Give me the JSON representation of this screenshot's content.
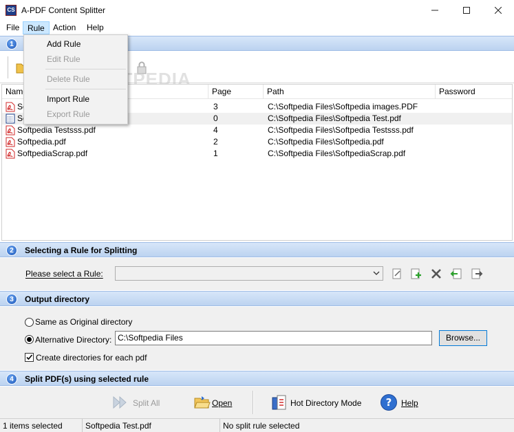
{
  "window": {
    "title": "A-PDF Content Splitter",
    "app_icon_text": "CS"
  },
  "menubar": {
    "items": [
      {
        "label": "File"
      },
      {
        "label": "Rule",
        "active": true
      },
      {
        "label": "Action"
      },
      {
        "label": "Help"
      }
    ]
  },
  "rule_menu": {
    "items": [
      {
        "label": "Add Rule",
        "enabled": true
      },
      {
        "label": "Edit Rule",
        "enabled": false
      },
      {
        "label": "Delete Rule",
        "enabled": false
      },
      {
        "label": "Import Rule",
        "enabled": true
      },
      {
        "label": "Export Rule",
        "enabled": false
      }
    ]
  },
  "section1": {
    "number": "1"
  },
  "watermark": "SOFTPEDIA",
  "filelist": {
    "columns": [
      "Name",
      "Page",
      "Path",
      "Password"
    ],
    "rows": [
      {
        "name": "Softpedia images.PDF",
        "page": "3",
        "path": "C:\\Softpedia Files\\Softpedia images.PDF",
        "password": "",
        "selected": false,
        "icon": "pdf-icon"
      },
      {
        "name": "Softpedia Test.pdf",
        "page": "0",
        "path": "C:\\Softpedia Files\\Softpedia Test.pdf",
        "password": "",
        "selected": true,
        "icon": "pdf-selected-icon"
      },
      {
        "name": "Softpedia Testsss.pdf",
        "page": "4",
        "path": "C:\\Softpedia Files\\Softpedia Testsss.pdf",
        "password": "",
        "selected": false,
        "icon": "pdf-icon"
      },
      {
        "name": "Softpedia.pdf",
        "page": "2",
        "path": "C:\\Softpedia Files\\Softpedia.pdf",
        "password": "",
        "selected": false,
        "icon": "pdf-icon"
      },
      {
        "name": "SoftpediaScrap.pdf",
        "page": "1",
        "path": "C:\\Softpedia Files\\SoftpediaScrap.pdf",
        "password": "",
        "selected": false,
        "icon": "pdf-icon"
      }
    ]
  },
  "section2": {
    "number": "2",
    "title": "Selecting a Rule for Splitting",
    "rule_label": "Please select a Rule:",
    "rule_value": ""
  },
  "section3": {
    "number": "3",
    "title": "Output directory",
    "same_dir_label": "Same as Original directory",
    "alt_dir_label": "Alternative Directory:",
    "alt_dir_value": "C:\\Softpedia Files",
    "browse_label": "Browse...",
    "create_dirs_label": "Create directories for each pdf",
    "output_mode": "alternative",
    "create_dirs_checked": true
  },
  "section4": {
    "number": "4",
    "title": "Split PDF(s) using selected rule",
    "split_all_label": "Split All",
    "open_label": "Open",
    "hot_dir_label": "Hot Directory Mode",
    "help_label": "Help"
  },
  "statusbar": {
    "selection_count": "1 items selected",
    "current_file": "Softpedia Test.pdf",
    "rule_status": "No split rule selected"
  },
  "colors": {
    "section_header": "#c9dcf4",
    "accent": "#0078d7",
    "pdf_red": "#d12a2a"
  }
}
